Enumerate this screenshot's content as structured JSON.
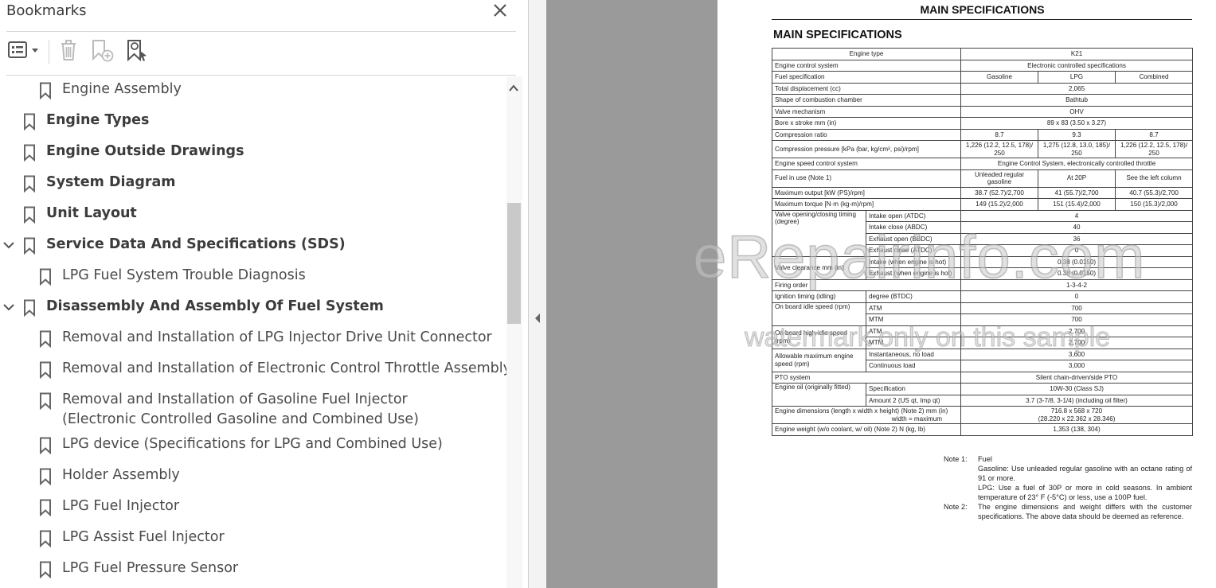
{
  "panel": {
    "title": "Bookmarks",
    "toolbar": {
      "options_icon": "list-options-icon",
      "delete_icon": "trash-icon",
      "new_bookmark_icon": "add-bookmark-icon",
      "find_bookmark_icon": "find-bookmark-icon"
    },
    "items": [
      {
        "label": "Engine Assembly",
        "level": 1,
        "expanded": null
      },
      {
        "label": "Engine Types",
        "level": 0,
        "expanded": null
      },
      {
        "label": "Engine Outside Drawings",
        "level": 0,
        "expanded": null
      },
      {
        "label": "System Diagram",
        "level": 0,
        "expanded": null
      },
      {
        "label": "Unit Layout",
        "level": 0,
        "expanded": null
      },
      {
        "label": "Service Data And Specifications (SDS)",
        "level": 0,
        "expanded": true
      },
      {
        "label": "LPG Fuel System Trouble Diagnosis",
        "level": 1,
        "expanded": null
      },
      {
        "label": "Disassembly And Assembly Of Fuel System",
        "level": 0,
        "expanded": true
      },
      {
        "label": "Removal and Installation of LPG Injector Drive Unit Connector",
        "level": 1,
        "expanded": null
      },
      {
        "label": "Removal and Installation of Electronic Control Throttle Assembly",
        "level": 1,
        "expanded": null
      },
      {
        "label": "Removal and Installation of Gasoline Fuel Injector (Electronic Controlled Gasoline and Combined Use)",
        "level": 1,
        "expanded": null
      },
      {
        "label": "LPG device (Specifications for LPG and Combined Use)",
        "level": 1,
        "expanded": null
      },
      {
        "label": "Holder Assembly",
        "level": 1,
        "expanded": null
      },
      {
        "label": "LPG Fuel Injector",
        "level": 1,
        "expanded": null
      },
      {
        "label": "LPG Assist Fuel Injector",
        "level": 1,
        "expanded": null
      },
      {
        "label": "LPG Fuel Pressure Sensor",
        "level": 1,
        "expanded": null
      }
    ]
  },
  "document": {
    "header": "MAIN SPECIFICATIONS",
    "section_title": "MAIN SPECIFICATIONS",
    "table": {
      "engine_type_label": "Engine type",
      "engine_type": "K21",
      "rows": {
        "engine_control_system": [
          "Engine control system",
          "Electronic controlled specifications"
        ],
        "fuel_spec": [
          "Fuel specification",
          "Gasoline",
          "LPG",
          "Combined"
        ],
        "displacement": [
          "Total displacement (cc)",
          "2,065"
        ],
        "combustion": [
          "Shape of combustion chamber",
          "Bathtub"
        ],
        "valve_mechanism": [
          "Valve mechanism",
          "OHV"
        ],
        "bore_stroke": [
          "Bore x stroke mm (in)",
          "89 x 83 (3.50 x 3.27)"
        ],
        "compression_ratio": [
          "Compression ratio",
          "8.7",
          "9.3",
          "8.7"
        ],
        "compression_pressure": [
          "Compression pressure [kPa (bar, kg/cm², psi)/rpm]",
          "1,226 (12.2, 12.5, 178)/ 250",
          "1,275 (12.8, 13.0, 185)/ 250",
          "1,226 (12.2, 12.5, 178)/ 250"
        ],
        "speed_control": [
          "Engine speed control system",
          "Engine Control System, electronically controlled throttle"
        ],
        "fuel_in_use": [
          "Fuel in use (Note 1)",
          "Unleaded regular gasoline",
          "At 20P",
          "See the left column"
        ],
        "max_output": [
          "Maximum output [kW (PS)/rpm]",
          "38.7 (52.7)/2,700",
          "41 (55.7)/2,700",
          "40.7 (55.3)/2,700"
        ],
        "max_torque": [
          "Maximum torque [N·m (kg-m)/rpm]",
          "149 (15.2)/2,000",
          "151 (15.4)/2,000",
          "150 (15.3)/2,000"
        ],
        "valve_timing": {
          "label": "Valve opening/closing timing (degree)",
          "items": [
            [
              "Intake open (ATDC)",
              "4"
            ],
            [
              "Intake close (ABDC)",
              "40"
            ],
            [
              "Exhaust open (BBDC)",
              "36"
            ],
            [
              "Exhaust close (ATDC)",
              "0"
            ]
          ]
        },
        "valve_clearance": {
          "label": "Valve clearance mm (in)",
          "items": [
            [
              "Intake (when engine is hot)",
              "0.38 (0.0150)"
            ],
            [
              "Exhaust (when engine is hot)",
              "0.38 (0.0150)"
            ]
          ]
        },
        "firing_order": [
          "Firing order",
          "1-3-4-2"
        ],
        "ignition_timing": [
          "Ignition timing (idling)",
          "degree (BTDC)",
          "0"
        ],
        "idle_speed": {
          "label": "On board idle speed (rpm)",
          "items": [
            [
              "ATM",
              "700"
            ],
            [
              "MTM",
              "700"
            ]
          ]
        },
        "high_idle": {
          "label": "On board high-idle speed (rpm)",
          "items": [
            [
              "ATM",
              "2,700"
            ],
            [
              "MTM",
              "2,700"
            ]
          ]
        },
        "max_speed": {
          "label": "Allowable maximum engine speed (rpm)",
          "items": [
            [
              "Instantaneous, no load",
              "3,600"
            ],
            [
              "Continuous load",
              "3,000"
            ]
          ]
        },
        "pto": [
          "PTO system",
          "Silent chain-driven/side PTO"
        ],
        "engine_oil": {
          "label": "Engine oil (originally fitted)",
          "items": [
            [
              "Specification",
              "10W-30 (Class SJ)"
            ],
            [
              "Amount 2 (US qt, Imp qt)",
              "3.7 (3-7/8, 3-1/4) (including oil filter)"
            ]
          ]
        },
        "dimensions": [
          "Engine dimensions (length x width x height) (Note 2) mm (in)",
          "width = maximum",
          "716.8 x 568 x 720",
          "(28.220 x 22.362 x 28.346)"
        ],
        "weight": [
          "Engine weight (w/o coolant, w/ oil) (Note 2) N (kg, lb)",
          "1,353 (138, 304)"
        ]
      }
    },
    "notes": {
      "note1_tag": "Note 1:",
      "note1_title": "Fuel",
      "note1_gasoline": "Gasoline: Use unleaded regular gasoline with an octane rating of 91 or more.",
      "note1_lpg": "LPG: Use a fuel of 30P or more in cold seasons. In ambient temperature of 23° F (-5°C) or less, use a 100P fuel.",
      "note2_tag": "Note 2:",
      "note2_body": "The engine dimensions and weight differs with the customer specifications. The above data should be deemed as reference."
    },
    "watermark_main": "eRepairinfo.com",
    "watermark_sub": "watermark only on this sample"
  }
}
